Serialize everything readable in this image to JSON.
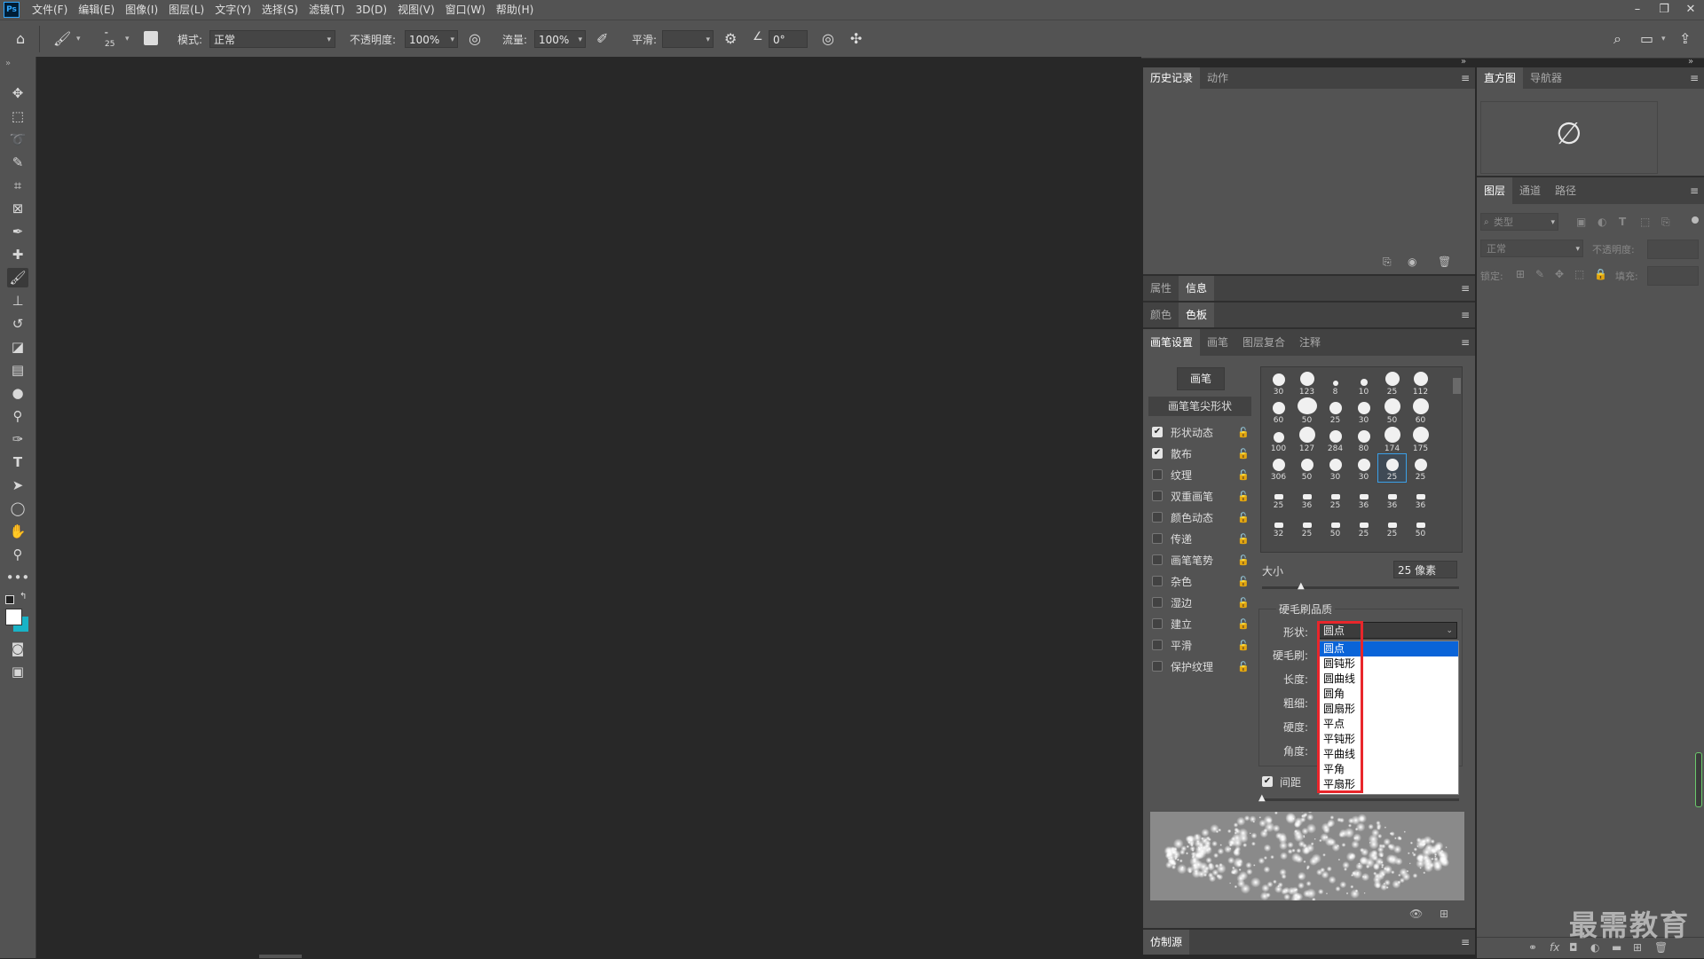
{
  "menu": {
    "logo": "Ps",
    "items": [
      "文件(F)",
      "编辑(E)",
      "图像(I)",
      "图层(L)",
      "文字(Y)",
      "选择(S)",
      "滤镜(T)",
      "3D(D)",
      "视图(V)",
      "窗口(W)",
      "帮助(H)"
    ]
  },
  "options": {
    "brush_size": "25",
    "mode_label": "模式:",
    "mode_value": "正常",
    "opacity_label": "不透明度:",
    "opacity_value": "100%",
    "flow_label": "流量:",
    "flow_value": "100%",
    "smoothing_label": "平滑:",
    "angle_value": "0°"
  },
  "history_panel": {
    "tabs": [
      "历史记录",
      "动作"
    ]
  },
  "info_panel": {
    "tabs": [
      "属性",
      "信息"
    ]
  },
  "color_panel": {
    "tabs": [
      "颜色",
      "色板"
    ]
  },
  "brush_settings": {
    "tabs": [
      "画笔设置",
      "画笔",
      "图层复合",
      "注释"
    ],
    "brush_button": "画笔",
    "tip_shape_header": "画笔笔尖形状",
    "options": [
      {
        "label": "形状动态",
        "checked": true
      },
      {
        "label": "散布",
        "checked": true
      },
      {
        "label": "纹理",
        "checked": false
      },
      {
        "label": "双重画笔",
        "checked": false
      },
      {
        "label": "颜色动态",
        "checked": false
      },
      {
        "label": "传递",
        "checked": false
      },
      {
        "label": "画笔笔势",
        "checked": false
      },
      {
        "label": "杂色",
        "checked": false
      },
      {
        "label": "湿边",
        "checked": false
      },
      {
        "label": "建立",
        "checked": false
      },
      {
        "label": "平滑",
        "checked": false
      },
      {
        "label": "保护纹理",
        "checked": false
      }
    ],
    "presets": [
      "30",
      "123",
      "8",
      "10",
      "25",
      "112",
      "60",
      "50",
      "25",
      "30",
      "50",
      "60",
      "100",
      "127",
      "284",
      "80",
      "174",
      "175",
      "306",
      "50",
      "30",
      "30",
      "25",
      "25",
      "25",
      "36",
      "25",
      "36",
      "36",
      "36",
      "32",
      "25",
      "50",
      "25",
      "25",
      "50"
    ],
    "size_label": "大小",
    "size_value": "25 像素",
    "bristle_title": "硬毛刷品质",
    "shape_label": "形状:",
    "shape_value": "圆点",
    "bristles_label": "硬毛刷:",
    "length_label": "长度:",
    "thickness_label": "粗细:",
    "stiffness_label": "硬度:",
    "angle_label": "角度:",
    "spacing_label": "间距",
    "shape_options": [
      "圆点",
      "圆钝形",
      "圆曲线",
      "圆角",
      "圆扇形",
      "平点",
      "平钝形",
      "平曲线",
      "平角",
      "平扇形"
    ]
  },
  "clone_panel": {
    "tabs": [
      "仿制源"
    ]
  },
  "histogram_panel": {
    "tabs": [
      "直方图",
      "导航器"
    ]
  },
  "layers_panel": {
    "tabs": [
      "图层",
      "通道",
      "路径"
    ],
    "filter_placeholder": "类型",
    "blend_mode": "正常",
    "opacity_label": "不透明度:",
    "lock_label": "锁定:",
    "fill_label": "填充:"
  },
  "watermark": "最需教育",
  "colors": {
    "highlight": "#e8262b",
    "selected": "#0a64d8",
    "fg_swatch": "#ffffff",
    "bg_swatch": "#19b3c6"
  }
}
